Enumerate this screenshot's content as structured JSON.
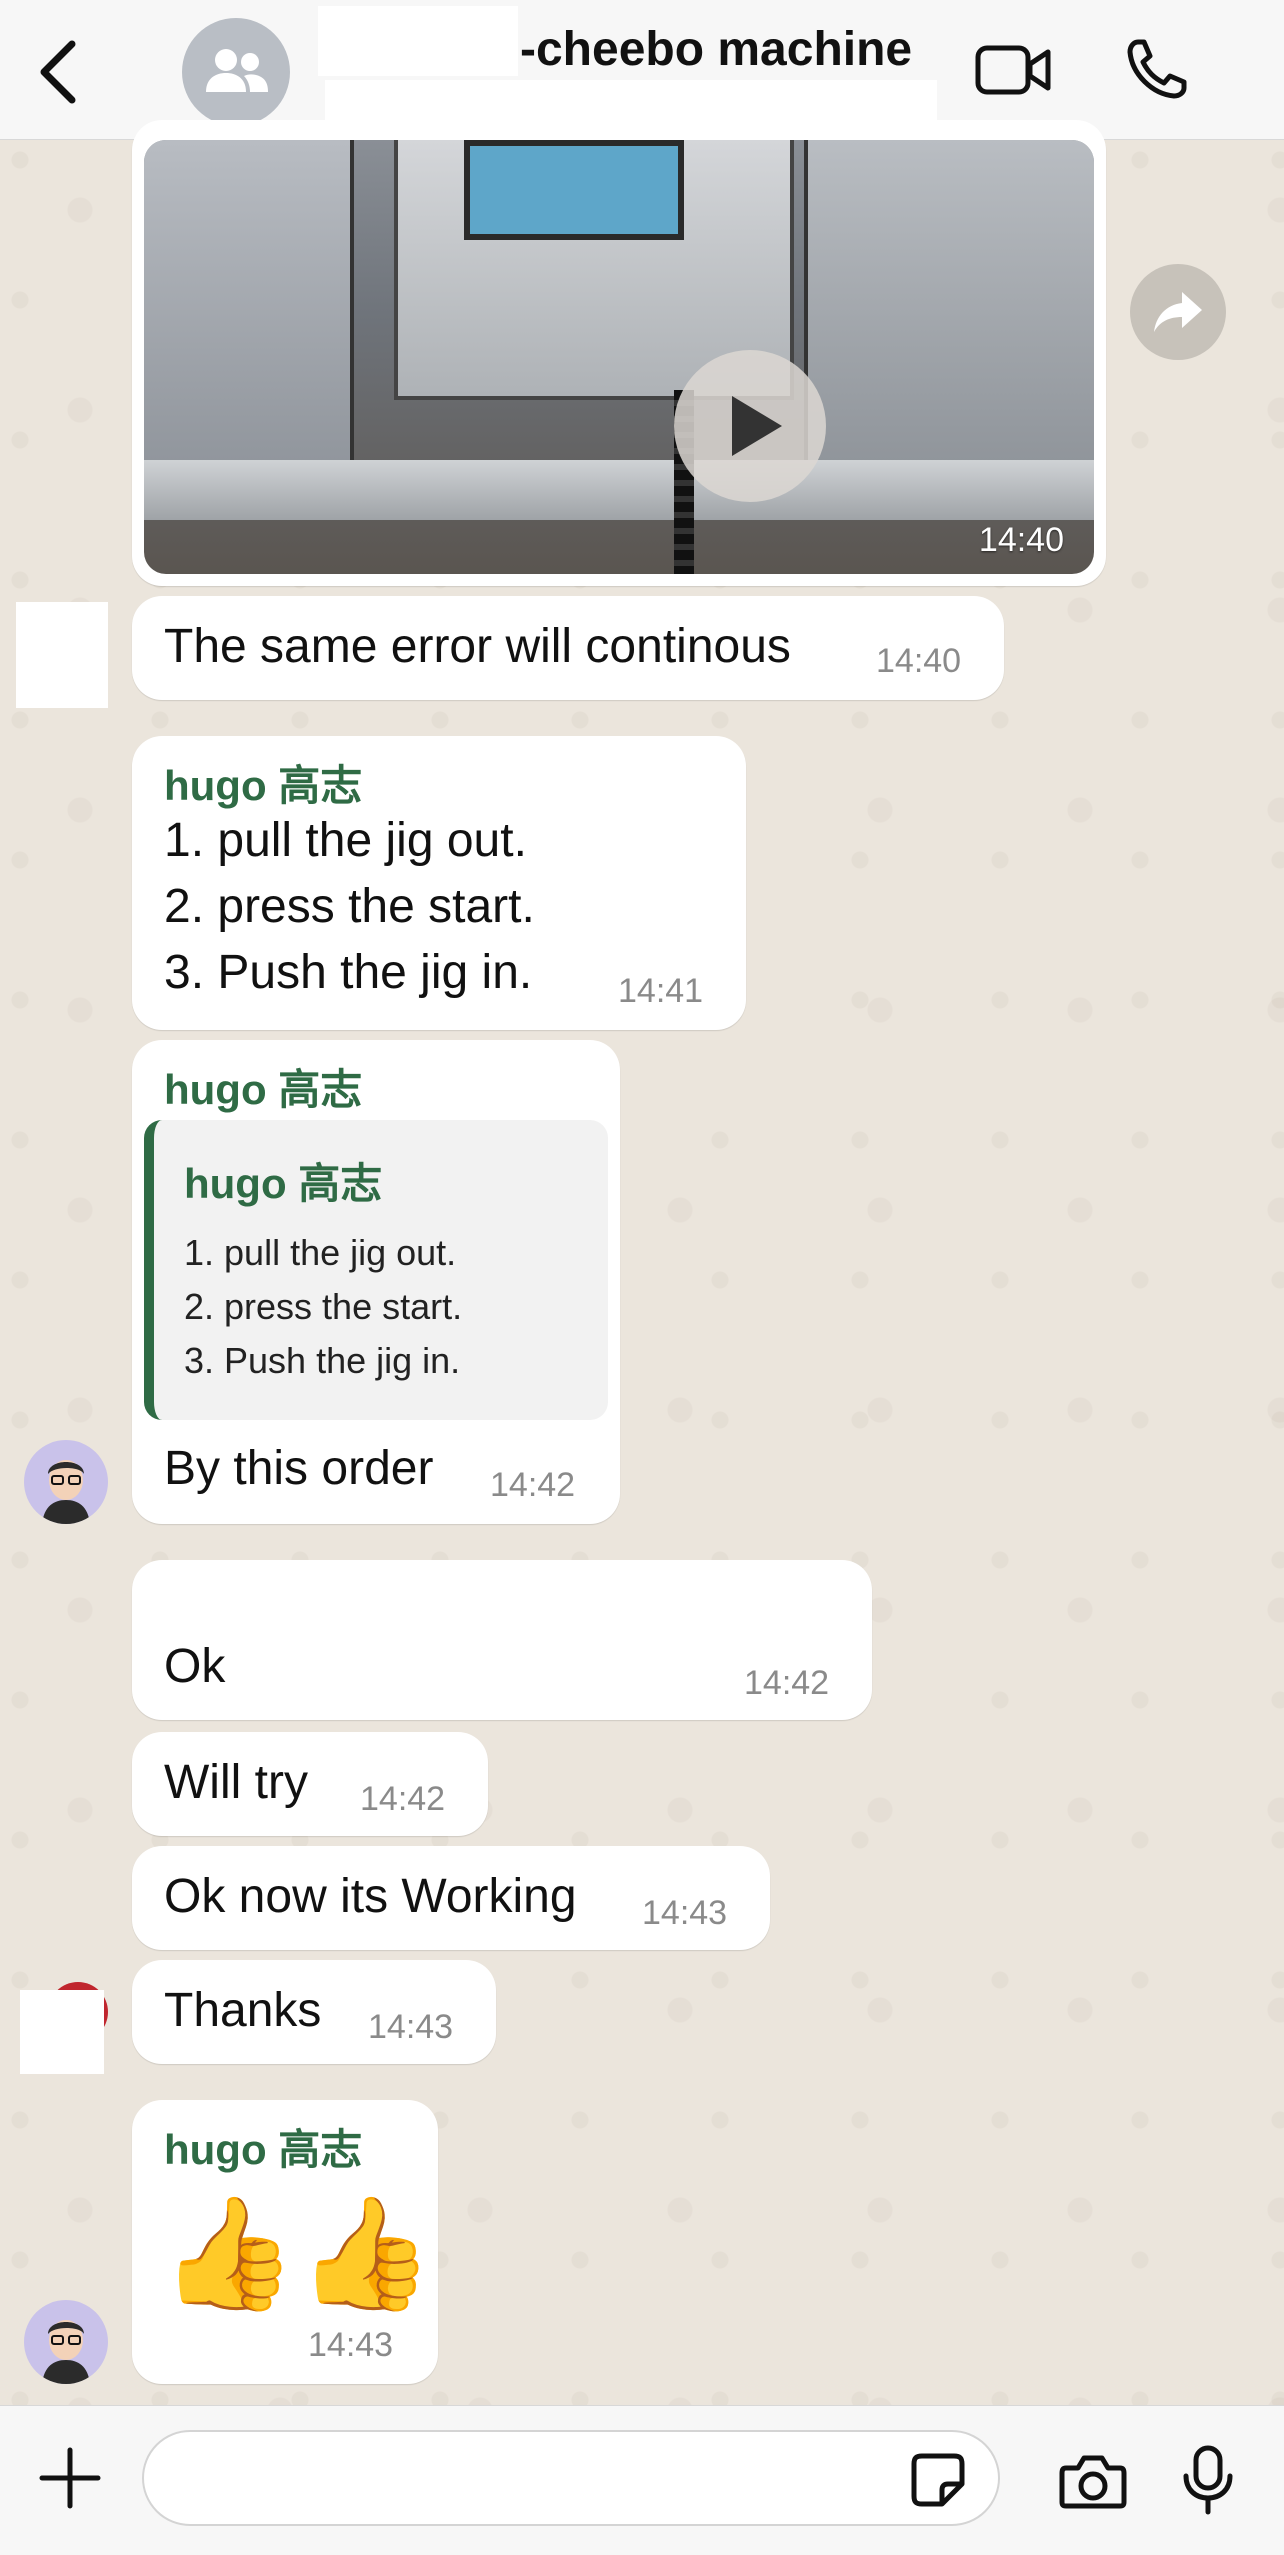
{
  "header": {
    "title": "-cheebo machine",
    "back_icon": "chevron-left-icon",
    "avatar_icon": "group-icon",
    "video_call_icon": "video-camera-icon",
    "voice_call_icon": "phone-icon"
  },
  "messages": [
    {
      "type": "video",
      "time": "14:40"
    },
    {
      "type": "text",
      "text": "The same error will continous",
      "time": "14:40"
    },
    {
      "type": "text",
      "sender": "hugo 高志",
      "lines": [
        "1. pull the jig out.",
        "2. press the start.",
        "3. Push the jig in."
      ],
      "time": "14:41"
    },
    {
      "type": "reply",
      "sender": "hugo 高志",
      "quote": {
        "sender": "hugo 高志",
        "lines": [
          "1. pull the jig out.",
          "2. press the start.",
          "3. Push the jig in."
        ]
      },
      "text": "By this order",
      "time": "14:42"
    },
    {
      "type": "text",
      "text": "Ok",
      "time": "14:42"
    },
    {
      "type": "text",
      "text": "Will try",
      "time": "14:42"
    },
    {
      "type": "text",
      "text": "Ok now its Working",
      "time": "14:43"
    },
    {
      "type": "text",
      "text": "Thanks",
      "time": "14:43"
    },
    {
      "type": "emoji",
      "sender": "hugo 高志",
      "text": "👍👍",
      "time": "14:43"
    }
  ],
  "input_bar": {
    "placeholder": "",
    "plus_icon": "plus-icon",
    "sticker_icon": "sticker-icon",
    "camera_icon": "camera-icon",
    "mic_icon": "microphone-icon"
  },
  "colors": {
    "sender_name": "#2f6b45",
    "bubble": "#ffffff",
    "chat_background": "#efeae2",
    "timestamp": "#8a8a8a"
  }
}
